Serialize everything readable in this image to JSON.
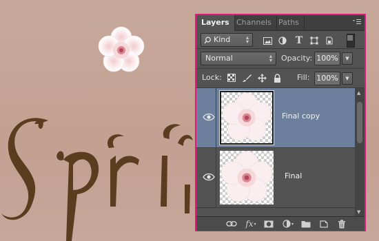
{
  "canvas": {
    "background_color": "#c4a397",
    "artwork_text": "Spri",
    "text_color": "#5a3d1f"
  },
  "layers_panel": {
    "tabs": [
      {
        "label": "Layers",
        "active": true
      },
      {
        "label": "Channels",
        "active": false
      },
      {
        "label": "Paths",
        "active": false
      }
    ],
    "filter": {
      "label": "Kind"
    },
    "blend_mode": "Normal",
    "opacity_label": "Opacity:",
    "opacity_value": "100%",
    "lock_label": "Lock:",
    "fill_label": "Fill:",
    "fill_value": "100%",
    "layers": [
      {
        "name": "Final copy",
        "selected": true,
        "visible": true
      },
      {
        "name": "Final",
        "selected": false,
        "visible": true
      }
    ],
    "bottom_icons": [
      "link-icon",
      "fx-icon",
      "mask-icon",
      "adjustment-icon",
      "folder-icon",
      "new-layer-icon",
      "trash-icon"
    ],
    "fx_label": "fx",
    "highlight_color": "#e5187b",
    "selected_color": "#6c7f9c"
  }
}
